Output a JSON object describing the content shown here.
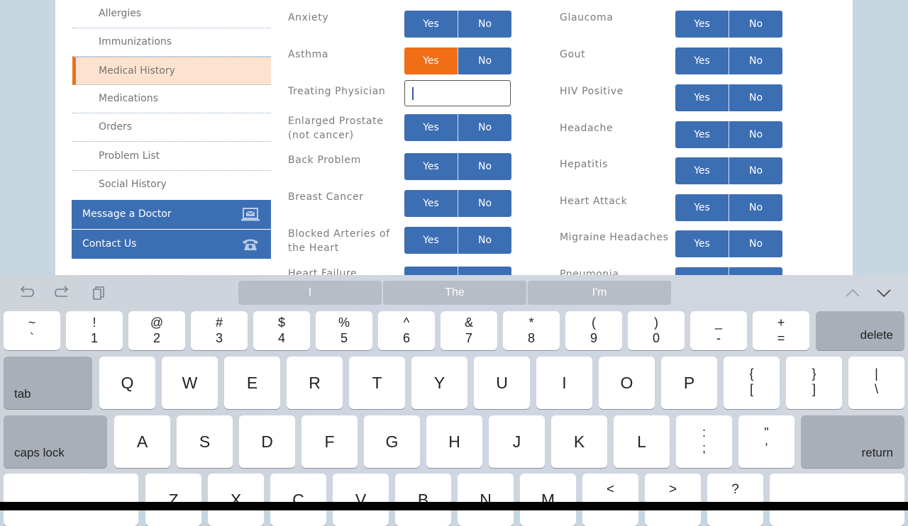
{
  "sidebar": {
    "items": [
      {
        "label": "Allergies",
        "active": false
      },
      {
        "label": "Immunizations",
        "active": false
      },
      {
        "label": "Medical History",
        "active": true
      },
      {
        "label": "Medications",
        "active": false
      },
      {
        "label": "Orders",
        "active": false
      },
      {
        "label": "Problem List",
        "active": false
      },
      {
        "label": "Social History",
        "active": false
      }
    ],
    "actions": [
      {
        "label": "Message a Doctor",
        "icon": "laptop-mail-icon"
      },
      {
        "label": "Contact Us",
        "icon": "phone-icon"
      }
    ]
  },
  "colors": {
    "accent_blue": "#3c6eb4",
    "selected_orange": "#ef6e16",
    "active_row_bg": "#fde3cf"
  },
  "form": {
    "yes_label": "Yes",
    "no_label": "No",
    "left_column": [
      {
        "label": "Anxiety",
        "type": "yesno",
        "value": null
      },
      {
        "label": "Asthma",
        "type": "yesno",
        "value": "Yes"
      },
      {
        "label": "Treating Physician",
        "type": "text",
        "value": "",
        "focused": true
      },
      {
        "label": "Enlarged Prostate (not cancer)",
        "type": "yesno",
        "value": null
      },
      {
        "label": "Back Problem",
        "type": "yesno",
        "value": null
      },
      {
        "label": "Breast Cancer",
        "type": "yesno",
        "value": null
      },
      {
        "label": "Blocked Arteries of the Heart",
        "type": "yesno",
        "value": null
      },
      {
        "label": "Heart Failure",
        "type": "yesno",
        "value": null
      }
    ],
    "right_column": [
      {
        "label": "Glaucoma",
        "type": "yesno",
        "value": null
      },
      {
        "label": "Gout",
        "type": "yesno",
        "value": null
      },
      {
        "label": "HIV Positive",
        "type": "yesno",
        "value": null
      },
      {
        "label": "Headache",
        "type": "yesno",
        "value": null
      },
      {
        "label": "Hepatitis",
        "type": "yesno",
        "value": null
      },
      {
        "label": "Heart Attack",
        "type": "yesno",
        "value": null
      },
      {
        "label": "Migraine Headaches",
        "type": "yesno",
        "value": null
      },
      {
        "label": "Pneumonia",
        "type": "yesno",
        "value": null
      }
    ]
  },
  "keyboard": {
    "toolbar": {
      "left_icons": [
        "undo-icon",
        "redo-icon",
        "paste-icon"
      ],
      "suggestions": [
        "I",
        "The",
        "I'm"
      ],
      "right_icons": [
        "chevron-up-icon",
        "chevron-down-icon"
      ]
    },
    "row1": [
      {
        "up": "~",
        "dn": "`"
      },
      {
        "up": "!",
        "dn": "1"
      },
      {
        "up": "@",
        "dn": "2"
      },
      {
        "up": "#",
        "dn": "3"
      },
      {
        "up": "$",
        "dn": "4"
      },
      {
        "up": "%",
        "dn": "5"
      },
      {
        "up": "^",
        "dn": "6"
      },
      {
        "up": "&",
        "dn": "7"
      },
      {
        "up": "*",
        "dn": "8"
      },
      {
        "up": "(",
        "dn": "9"
      },
      {
        "up": ")",
        "dn": "0"
      },
      {
        "up": "_",
        "dn": "-"
      },
      {
        "up": "+",
        "dn": "="
      }
    ],
    "delete_label": "delete",
    "tab_label": "tab",
    "row2": [
      "Q",
      "W",
      "E",
      "R",
      "T",
      "Y",
      "U",
      "I",
      "O",
      "P"
    ],
    "row2_symbols": [
      {
        "up": "{",
        "dn": "["
      },
      {
        "up": "}",
        "dn": "]"
      },
      {
        "up": "|",
        "dn": "\\"
      }
    ],
    "caps_label": "caps lock",
    "row3": [
      "A",
      "S",
      "D",
      "F",
      "G",
      "H",
      "J",
      "K",
      "L"
    ],
    "row3_symbols": [
      {
        "up": ":",
        "dn": ";"
      },
      {
        "up": "\"",
        "dn": "'"
      }
    ],
    "return_label": "return",
    "row4": [
      "Z",
      "X",
      "C",
      "V",
      "B",
      "N",
      "M"
    ],
    "row4_symbols": [
      "<",
      ">",
      "?"
    ]
  }
}
